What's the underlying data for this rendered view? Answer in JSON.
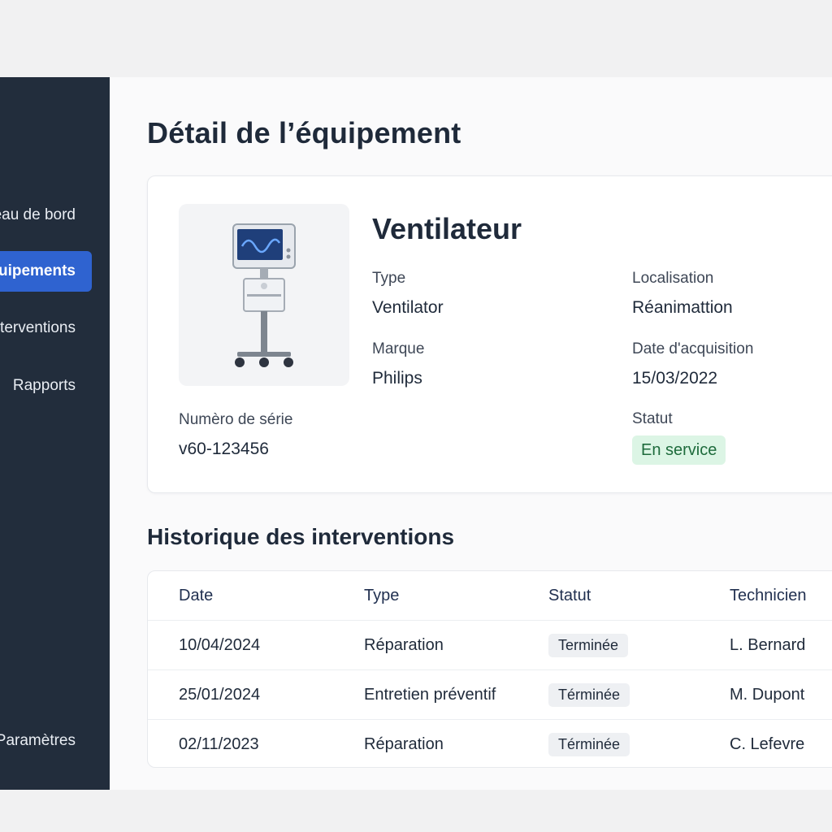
{
  "sidebar": {
    "items": [
      {
        "label": "Tableau de bord",
        "active": false
      },
      {
        "label": "Équipements",
        "active": true
      },
      {
        "label": "Interventions",
        "active": false
      },
      {
        "label": "Rapports",
        "active": false
      }
    ],
    "bottom_item": "Paramètres"
  },
  "page_title": "Détail de l’équipement",
  "equipment": {
    "name": "Ventilateur",
    "type_label": "Type",
    "type_value": "Ventilator",
    "location_label": "Localisation",
    "location_value": "Réanimattion",
    "brand_label": "Marque",
    "brand_value": "Philips",
    "acq_label": "Date d'acquisition",
    "acq_value": "15/03/2022",
    "serial_label": "Numèro de série",
    "serial_value": "v60-123456",
    "status_label": "Statut",
    "status_value": "En service",
    "image_icon": "ventilator-icon"
  },
  "history": {
    "title": "Historique des interventions",
    "headers": [
      "Date",
      "Type",
      "Statut",
      "Technicien"
    ],
    "rows": [
      {
        "date": "10/04/2024",
        "type": "Réparation",
        "status": "Terminée",
        "tech": "L. Bernard"
      },
      {
        "date": "25/01/2024",
        "type": "Entretien préventif",
        "status": "Términée",
        "tech": "M. Dupont"
      },
      {
        "date": "02/11/2023",
        "type": "Réparation",
        "status": "Términée",
        "tech": "C. Lefevre"
      }
    ]
  },
  "colors": {
    "sidebar_bg": "#222d3c",
    "active_accent": "#2f63d0",
    "status_ok_bg": "#dcf5e5",
    "status_ok_text": "#1e6b3c"
  }
}
